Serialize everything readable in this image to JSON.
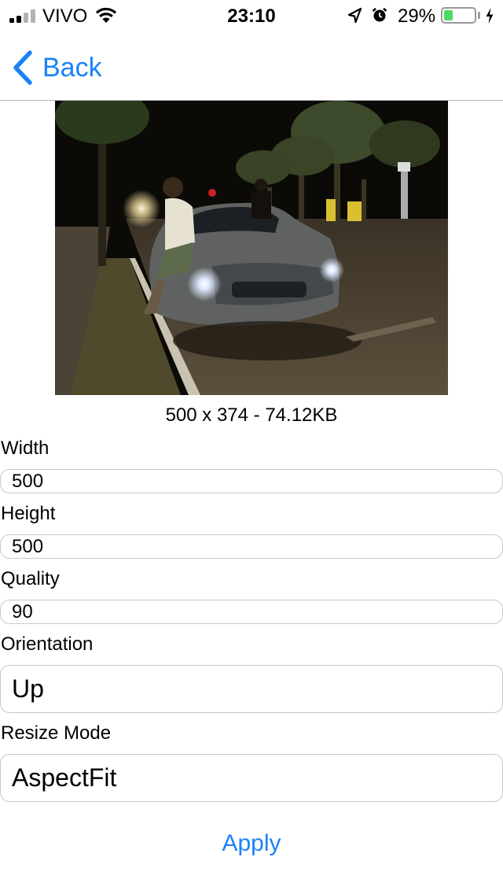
{
  "status_bar": {
    "carrier": "VIVO",
    "time": "23:10",
    "battery_percent": "29%",
    "battery_level": 0.29,
    "signal_bars_active": 2,
    "signal_bars_total": 4,
    "battery_color": "#4cd964"
  },
  "nav": {
    "back_label": "Back",
    "accent_color": "#1a82f7"
  },
  "image": {
    "info": "500 x 374 - 74.12KB"
  },
  "form": {
    "width_label": "Width",
    "width_value": "500",
    "height_label": "Height",
    "height_value": "500",
    "quality_label": "Quality",
    "quality_value": "90",
    "orientation_label": "Orientation",
    "orientation_value": "Up",
    "resize_mode_label": "Resize Mode",
    "resize_mode_value": "AspectFit",
    "apply_label": "Apply"
  }
}
